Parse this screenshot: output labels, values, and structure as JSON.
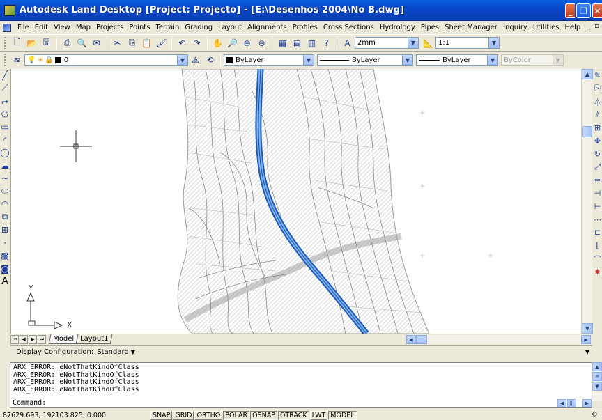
{
  "window": {
    "title": "Autodesk Land Desktop [Project: Projecto] - [E:\\Desenhos 2004\\No B.dwg]",
    "buttons": [
      "_",
      "❐",
      "✕"
    ]
  },
  "menu": {
    "items": [
      "File",
      "Edit",
      "View",
      "Map",
      "Projects",
      "Points",
      "Terrain",
      "Grading",
      "Layout",
      "Alignments",
      "Profiles",
      "Cross Sections",
      "Hydrology",
      "Pipes",
      "Sheet Manager",
      "Inquiry",
      "Utilities",
      "Help"
    ],
    "mdi_buttons": [
      "_",
      "▫"
    ]
  },
  "toolbar1": {
    "text_height": "2mm",
    "scale": "1:1"
  },
  "toolbar2": {
    "layer": "0",
    "color": "ByLayer",
    "linetype": "ByLayer",
    "lineweight": "ByLayer",
    "plotstyle": "ByColor"
  },
  "drawing": {
    "ucs_x_label": "X",
    "ucs_y_label": "Y"
  },
  "layout_tabs": {
    "model": "Model",
    "layout1": "Layout1"
  },
  "display_config": {
    "label": "Display Configuration:",
    "value": "Standard"
  },
  "command_window": {
    "history": [
      "ARX_ERROR: eNotThatKindOfClass",
      "ARX_ERROR: eNotThatKindOfClass",
      "ARX_ERROR: eNotThatKindOfClass",
      "ARX_ERROR: eNotThatKindOfClass"
    ],
    "prompt": "Command:"
  },
  "status": {
    "coordinates": "87629.693, 192103.825, 0.000",
    "toggles": [
      "SNAP",
      "GRID",
      "ORTHO",
      "POLAR",
      "OSNAP",
      "OTRACK",
      "LWT",
      "MODEL"
    ]
  },
  "colors": {
    "titlebar": "#0846c9",
    "road": "#3a7fd4",
    "contours": "#9a9a9a"
  }
}
